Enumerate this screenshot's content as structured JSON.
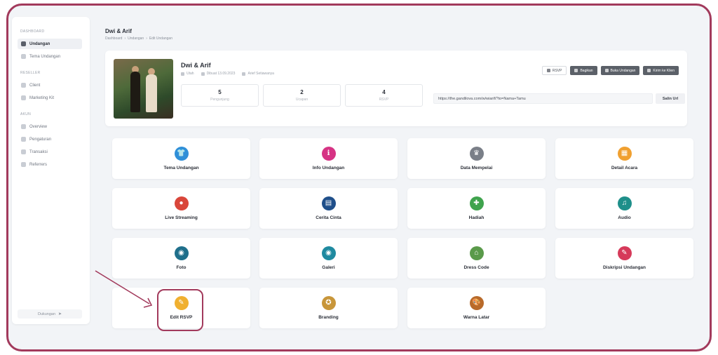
{
  "sidebar": {
    "sections": [
      {
        "label": "DASHBOARD",
        "items": [
          {
            "label": "Undangan",
            "active": true
          },
          {
            "label": "Tema Undangan",
            "active": false
          }
        ]
      },
      {
        "label": "RESELLER",
        "items": [
          {
            "label": "Client",
            "active": false
          },
          {
            "label": "Marketing Kit",
            "active": false
          }
        ]
      },
      {
        "label": "AKUN",
        "items": [
          {
            "label": "Overview",
            "active": false
          },
          {
            "label": "Pengaturan",
            "active": false
          },
          {
            "label": "Transaksi",
            "active": false
          },
          {
            "label": "Referrers",
            "active": false
          }
        ]
      }
    ],
    "footer_label": "Dukungan"
  },
  "header": {
    "title": "Dwi & Arif",
    "breadcrumb": [
      "Dashboard",
      "Undangan",
      "Edit Undangan"
    ],
    "breadcrumb_sep": "›"
  },
  "profile": {
    "name": "Dwi & Arif",
    "meta": [
      "Utah",
      "Dibuat 13.09.2023",
      "Arief Setiawanya"
    ],
    "stats": [
      {
        "value": "5",
        "label": "Pengunjung"
      },
      {
        "value": "2",
        "label": "Ucapan"
      },
      {
        "value": "4",
        "label": "RSVP"
      }
    ],
    "actions": [
      {
        "label": "RSVP",
        "style": "outline"
      },
      {
        "label": "Bagikan",
        "style": "dark"
      },
      {
        "label": "Buka Undangan",
        "style": "dark"
      },
      {
        "label": "Kirim ke Klien",
        "style": "dark"
      }
    ],
    "url": "https://the.gandilova.com/w/wiarif/?to=Nama+Tamu",
    "copy_label": "Salin Url"
  },
  "menu": [
    {
      "label": "Tema Undangan",
      "icon": "tshirt-icon",
      "glyph": "👕",
      "color": "#2f8fd8"
    },
    {
      "label": "Info Undangan",
      "icon": "info-icon",
      "glyph": "ℹ",
      "color": "#d63384"
    },
    {
      "label": "Data Mempelai",
      "icon": "crown-icon",
      "glyph": "♛",
      "color": "#7a7f88"
    },
    {
      "label": "Detail Acara",
      "icon": "calendar-icon",
      "glyph": "▦",
      "color": "#f0a030"
    },
    {
      "label": "Live Streaming",
      "icon": "live-icon",
      "glyph": "●",
      "color": "#d9463a"
    },
    {
      "label": "Cerita Cinta",
      "icon": "book-icon",
      "glyph": "▤",
      "color": "#1f4f8a"
    },
    {
      "label": "Hadiah",
      "icon": "gift-icon",
      "glyph": "✚",
      "color": "#3fa34d"
    },
    {
      "label": "Audio",
      "icon": "headphones-icon",
      "glyph": "♫",
      "color": "#1e8f8a"
    },
    {
      "label": "Foto",
      "icon": "camera-icon",
      "glyph": "◉",
      "color": "#1f6f8b"
    },
    {
      "label": "Galeri",
      "icon": "gallery-icon",
      "glyph": "◉",
      "color": "#1f8aa0"
    },
    {
      "label": "Dress Code",
      "icon": "hanger-icon",
      "glyph": "⌂",
      "color": "#5a9a4a"
    },
    {
      "label": "Diskripsi Undangan",
      "icon": "document-icon",
      "glyph": "✎",
      "color": "#d63a5a"
    },
    {
      "label": "Edit RSVP",
      "icon": "pencil-icon",
      "glyph": "✎",
      "color": "#f0b030"
    },
    {
      "label": "Branding",
      "icon": "badge-icon",
      "glyph": "✪",
      "color": "#c8963a"
    },
    {
      "label": "Warna Latar",
      "icon": "palette-icon",
      "glyph": "🎨",
      "color": "#b86a2a"
    }
  ],
  "colors": {
    "accent": "#a23a5c",
    "background": "#f2f4f7"
  }
}
